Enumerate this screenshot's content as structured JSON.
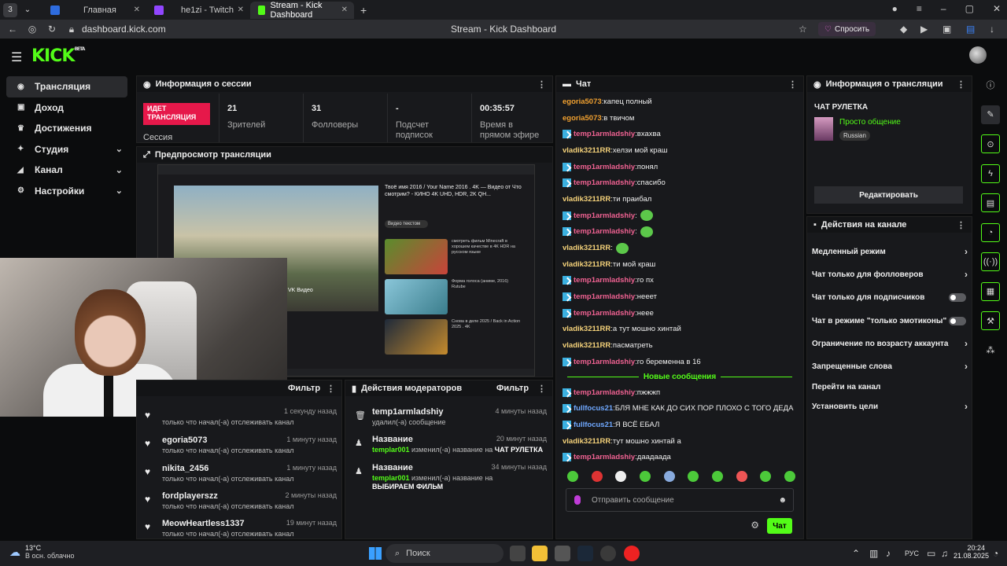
{
  "browser": {
    "tabs": [
      {
        "label": "Главная",
        "color": "#2e6cdf"
      },
      {
        "label": "he1zi - Twitch",
        "color": "#9146ff"
      },
      {
        "label": "Stream - Kick Dashboard",
        "color": "#53fc18"
      }
    ],
    "tab_counter": "3",
    "url": "dashboard.kick.com",
    "page_title": "Stream - Kick Dashboard",
    "ask_label": "Спросить"
  },
  "header": {
    "logo": "KICK",
    "logo_badge": "BETA"
  },
  "sidebar": {
    "items": [
      {
        "label": "Трансляция",
        "icon": "broadcast-icon"
      },
      {
        "label": "Доход",
        "icon": "wallet-icon"
      },
      {
        "label": "Достижения",
        "icon": "trophy-icon"
      },
      {
        "label": "Студия",
        "icon": "studio-icon"
      },
      {
        "label": "Канал",
        "icon": "channel-icon"
      },
      {
        "label": "Настройки",
        "icon": "gear-icon"
      }
    ]
  },
  "session": {
    "title": "Информация о сессии",
    "live_badge": "ИДЕТ ТРАНСЛЯЦИЯ",
    "label": "Сессия",
    "stats": [
      {
        "value": "21",
        "label": "Зрителей"
      },
      {
        "value": "31",
        "label": "Фолловеры"
      },
      {
        "value": "-",
        "label": "Подсчет подписок"
      },
      {
        "value": "00:35:57",
        "label": "Время в прямом эфире"
      }
    ]
  },
  "preview": {
    "title": "Предпросмотр трансляции",
    "video_title": "Твоё имя 2016 / Your Name 2016 . 4K — Видео от Что смотрим? - КИНО 4K UHD, HDR, 2K QH...",
    "video_button": "Видео текстом",
    "rec": [
      {
        "title": "смотреть фильм Minecraft в хорошем качестве в 4K HDR на русском языке"
      },
      {
        "title": "Форма голоса (аниме, 2016) Rutube"
      },
      {
        "title": "Снова в деле 2025 / Back in Action 2025 . 4K"
      }
    ],
    "player_label": "VK Видео"
  },
  "followers": {
    "filter_label": "Фильтр",
    "items": [
      {
        "name": "",
        "time": "1 секунду назад",
        "desc": "только что начал(-а) отслеживать канал"
      },
      {
        "name": "egoria5073",
        "time": "1 минуту назад",
        "desc": "только что начал(-а) отслеживать канал"
      },
      {
        "name": "nikita_2456",
        "time": "1 минуту назад",
        "desc": "только что начал(-а) отслеживать канал"
      },
      {
        "name": "fordplayerszz",
        "time": "2 минуты назад",
        "desc": "только что начал(-а) отслеживать канал"
      },
      {
        "name": "MeowHeartless1337",
        "time": "19 минут назад",
        "desc": "только что начал(-а) отслеживать канал"
      }
    ]
  },
  "mod_actions": {
    "title": "Действия модераторов",
    "filter_label": "Фильтр",
    "items": [
      {
        "name": "temp1armladshiy",
        "time": "4 минуты назад",
        "desc": "удалил(-а) сообщение",
        "actor": "",
        "target": "",
        "icon": "trash-icon"
      },
      {
        "name": "Название",
        "time": "20 минут назад",
        "actor": "templar001",
        "desc": " изменил(-а) название на ",
        "target": "ЧАТ РУЛЕТКА",
        "icon": "user-edit-icon"
      },
      {
        "name": "Название",
        "time": "34 минуты назад",
        "actor": "templar001",
        "desc": " изменил(-а) название на ",
        "target": "ВЫБИРАЕМ ФИЛЬМ",
        "icon": "user-edit-icon"
      }
    ]
  },
  "chat": {
    "title": "Чат",
    "messages": [
      {
        "user": "egoria5073",
        "color": "#f0a030",
        "text": "капец полный",
        "badge": false
      },
      {
        "user": "egoria5073",
        "color": "#f0a030",
        "text": "в твичом",
        "badge": false
      },
      {
        "user": "temp1armladshiy",
        "color": "#f06292",
        "text": "вхахва",
        "badge": true
      },
      {
        "user": "vladik3211RR",
        "color": "#f5d27a",
        "text": "хелзи мой краш",
        "badge": false
      },
      {
        "user": "temp1armladshiy",
        "color": "#f06292",
        "text": "понял",
        "badge": true
      },
      {
        "user": "temp1armladshiy",
        "color": "#f06292",
        "text": "спасибо",
        "badge": true
      },
      {
        "user": "vladik3211RR",
        "color": "#f5d27a",
        "text": "ти праибал",
        "badge": false
      },
      {
        "user": "temp1armladshiy",
        "color": "#f06292",
        "text": "",
        "badge": true,
        "emote": true
      },
      {
        "user": "temp1armladshiy",
        "color": "#f06292",
        "text": "",
        "badge": true,
        "emote": true
      },
      {
        "user": "vladik3211RR",
        "color": "#f5d27a",
        "text": "",
        "badge": false,
        "emote": true
      },
      {
        "user": "vladik3211RR",
        "color": "#f5d27a",
        "text": "ти мой краш",
        "badge": false
      },
      {
        "user": "temp1armladshiy",
        "color": "#f06292",
        "text": "го пх",
        "badge": true
      },
      {
        "user": "temp1armladshiy",
        "color": "#f06292",
        "text": "нееет",
        "badge": true
      },
      {
        "user": "temp1armladshiy",
        "color": "#f06292",
        "text": "неее",
        "badge": true
      },
      {
        "user": "vladik3211RR",
        "color": "#f5d27a",
        "text": "а тут мошно хинтай",
        "badge": false
      },
      {
        "user": "vladik3211RR",
        "color": "#f5d27a",
        "text": "пасматреть",
        "badge": false
      },
      {
        "user": "temp1armladshiy",
        "color": "#f06292",
        "text": "го беременна в 16",
        "badge": true
      }
    ],
    "new_label": "Новые сообщения",
    "new_messages": [
      {
        "user": "temp1armladshiy",
        "color": "#f06292",
        "text": "пжжжп",
        "badge": true
      },
      {
        "user": "fullfocus21",
        "color": "#6fa8ff",
        "text": "БЛЯ МНЕ КАК ДО СИХ ПОР ПЛОХО С ТОГО ДЕДА",
        "badge": true
      },
      {
        "user": "fullfocus21",
        "color": "#6fa8ff",
        "text": "Я ВСЁ ЕБАЛ",
        "badge": true
      },
      {
        "user": "vladik3211RR",
        "color": "#f5d27a",
        "text": "тут мошно хинтай а",
        "badge": false
      },
      {
        "user": "temp1armladshiy",
        "color": "#f06292",
        "text": "даадаада",
        "badge": true
      }
    ],
    "input_placeholder": "Отправить сообщение",
    "send_label": "Чат"
  },
  "stream_info": {
    "title": "Информация о трансляции",
    "stream_title": "ЧАТ РУЛЕТКА",
    "category": "Просто общение",
    "language": "Russian",
    "edit_label": "Редактировать"
  },
  "channel_actions": {
    "title": "Действия на канале",
    "items": [
      {
        "label": "Медленный режим",
        "type": "chevron"
      },
      {
        "label": "Чат только для фолловеров",
        "type": "chevron"
      },
      {
        "label": "Чат только для подписчиков",
        "type": "toggle"
      },
      {
        "label": "Чат в режиме \"только эмотиконы\"",
        "type": "toggle"
      },
      {
        "label": "Ограничение по возрасту аккаунта",
        "type": "chevron"
      },
      {
        "label": "Запрещенные слова",
        "type": "chevron"
      },
      {
        "label": "Перейти на канал",
        "type": "none"
      },
      {
        "label": "Установить цели",
        "type": "chevron"
      }
    ]
  },
  "taskbar": {
    "weather_temp": "13°C",
    "weather_desc": "В осн. облачно",
    "search_label": "Поиск",
    "lang": "РУС",
    "time": "20:24",
    "date": "21.08.2025"
  }
}
